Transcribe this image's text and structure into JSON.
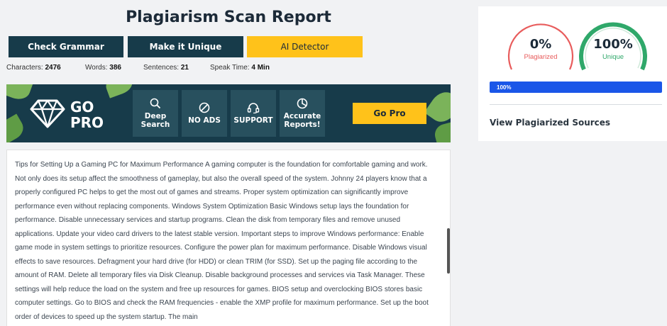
{
  "header": {
    "title": "Plagiarism Scan Report"
  },
  "toolbar": {
    "check_grammar": "Check Grammar",
    "make_unique": "Make it Unique",
    "ai_detector": "AI Detector"
  },
  "stats": {
    "characters_label": "Characters:",
    "characters_value": "2476",
    "words_label": "Words:",
    "words_value": "386",
    "sentences_label": "Sentences:",
    "sentences_value": "21",
    "speak_label": "Speak Time:",
    "speak_value": "4 Min"
  },
  "banner": {
    "go_line1": "GO",
    "go_line2": "PRO",
    "features": [
      {
        "icon": "search-icon",
        "line1": "Deep",
        "line2": "Search"
      },
      {
        "icon": "no-ads-icon",
        "line1": "NO ADS",
        "line2": ""
      },
      {
        "icon": "headset-icon",
        "line1": "SUPPORT",
        "line2": ""
      },
      {
        "icon": "pie-chart-icon",
        "line1": "Accurate",
        "line2": "Reports!"
      }
    ],
    "cta": "Go Pro",
    "colors": {
      "background": "#173b4a",
      "leaf": "#7bb35a",
      "accent": "#ffc21a"
    }
  },
  "content": {
    "text": "Tips for Setting Up a Gaming PC for Maximum Performance A gaming computer is the foundation for comfortable gaming and work. Not only does its setup affect the smoothness of gameplay, but also the overall speed of the system. Johnny 24 players know that a properly configured PC helps to get the most out of games and streams. Proper system optimization can significantly improve performance even without replacing components. Windows System Optimization Basic Windows setup lays the foundation for performance. Disable unnecessary services and startup programs. Clean the disk from temporary files and remove unused applications. Update your video card drivers to the latest stable version. Important steps to improve Windows performance: Enable game mode in system settings to prioritize resources. Configure the power plan for maximum performance. Disable Windows visual effects to save resources. Defragment your hard drive (for HDD) or clean TRIM (for SSD). Set up the paging file according to the amount of RAM. Delete all temporary files via Disk Cleanup. Disable background processes and services via Task Manager. These settings will help reduce the load on the system and free up resources for games. BIOS setup and overclocking BIOS stores basic computer settings. Go to BIOS and check the RAM frequencies - enable the XMP profile for maximum performance. Set up the boot order of devices to speed up the system startup. The main"
  },
  "results": {
    "plagiarized_value": "0%",
    "plagiarized_label": "Plagiarized",
    "plagiarized_fraction": 0,
    "unique_value": "100%",
    "unique_label": "Unique",
    "unique_fraction": 1,
    "progress_label": "100%",
    "progress_fraction": 1,
    "view_sources": "View Plagiarized Sources",
    "colors": {
      "plagiarized": "#e85c5c",
      "unique": "#2fa86a",
      "progress": "#1a56e8"
    }
  }
}
